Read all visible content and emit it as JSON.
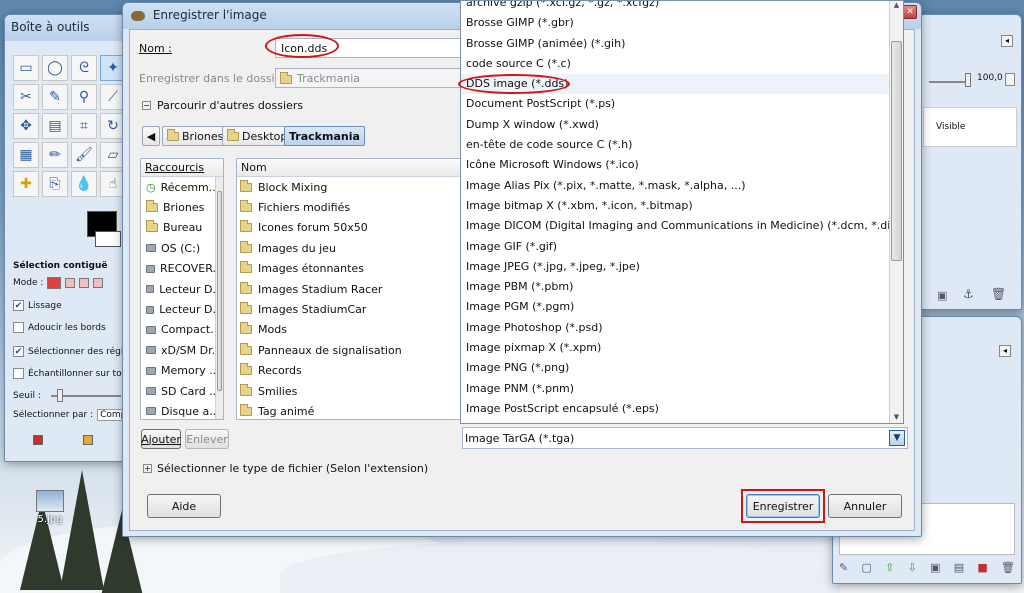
{
  "toolbox": {
    "title": "Boîte à outils",
    "options_title": "Sélection contiguë",
    "mode_label": "Mode :",
    "antialias_label": "Lissage",
    "feather_label": "Adoucir les bords",
    "select_transparent_label": "Sélectionner des régions",
    "sample_merged_label": "Échantillonner sur tous",
    "threshold_label": "Seuil :",
    "select_by_label": "Sélectionner par :",
    "select_by_value": "Composit"
  },
  "layers_panel": {
    "opacity_value": "100,0",
    "layer_name": "Visible"
  },
  "desktop": {
    "icon_label": "5.jpg"
  },
  "dialog": {
    "title": "Enregistrer l'image",
    "name_label": "Nom :",
    "name_value": "Icon.dds",
    "save_in_label": "Enregistrer dans le dossier :",
    "save_in_value": "Trackmania",
    "browse_label": "Parcourir d'autres dossiers",
    "breadcrumb": [
      "Briones",
      "Desktop",
      "Trackmania"
    ],
    "places_header": "Raccourcis",
    "places": [
      "Récemm...",
      "Briones",
      "Bureau",
      "OS (C:)",
      "RECOVER...",
      "Lecteur D...",
      "Lecteur D...",
      "Compact...",
      "xD/SM Dr...",
      "Memory ...",
      "SD Card ...",
      "Disque a..."
    ],
    "files_header": "Nom",
    "files": [
      "Block Mixing",
      "Fichiers modifiés",
      "Icones forum 50x50",
      "Images du jeu",
      "Images étonnantes",
      "Images Stadium Racer",
      "Images StadiumCar",
      "Mods",
      "Panneaux de signalisation",
      "Records",
      "Smilies",
      "Tag animé"
    ],
    "add_button": "Ajouter",
    "remove_button": "Enlever",
    "filetype_label": "Sélectionner le type de fichier (Selon l'extension)",
    "help_button": "Aide",
    "save_button": "Enregistrer",
    "cancel_button": "Annuler"
  },
  "filetype_dropdown": {
    "items": [
      "archive gzip (*.xcf.gz, *.gz, *.xcfgz)",
      "Brosse GIMP (*.gbr)",
      "Brosse GIMP (animée) (*.gih)",
      "code source C (*.c)",
      "DDS image (*.dds)",
      "Document PostScript (*.ps)",
      "Dump X window (*.xwd)",
      "en-tête de code source C (*.h)",
      "Icône Microsoft Windows (*.ico)",
      "Image Alias Pix (*.pix, *.matte, *.mask, *.alpha, ...)",
      "Image bitmap X (*.xbm, *.icon, *.bitmap)",
      "Image DICOM (Digital Imaging and Communications in Medicine) (*.dcm, *.dicom)",
      "Image GIF (*.gif)",
      "Image JPEG (*.jpg, *.jpeg, *.jpe)",
      "Image PBM (*.pbm)",
      "Image PGM (*.pgm)",
      "Image Photoshop (*.psd)",
      "Image pixmap X (*.xpm)",
      "Image PNG (*.png)",
      "Image PNM (*.pnm)",
      "Image PostScript encapsulé (*.eps)"
    ],
    "selected": "Image TarGA (*.tga)"
  },
  "colors": {
    "annotation": "#d21414",
    "accent": "#3c7fc7"
  }
}
